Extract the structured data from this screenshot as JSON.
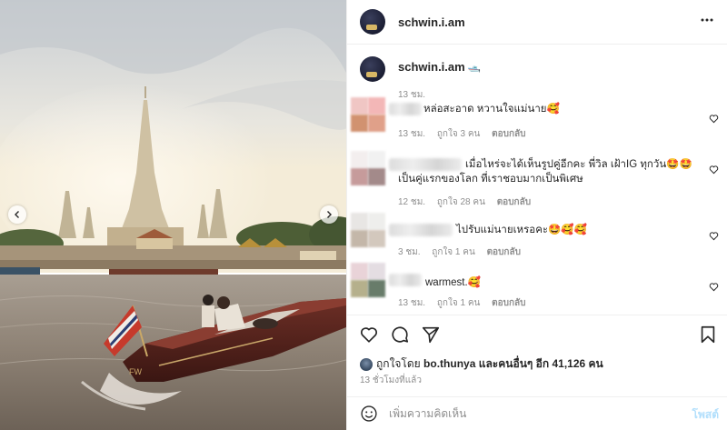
{
  "post": {
    "username": "schwin.i.am",
    "more_icon": "more-horizontal-icon",
    "caption": {
      "username": "schwin.i.am",
      "emoji": "🛥️",
      "time": "13 ชม."
    },
    "comments": [
      {
        "text": "หล่อสะอาด หวานใจแม่นาย🥰",
        "time": "13 ชม.",
        "likes": "ถูกใจ 3 คน",
        "reply": "ตอบกลับ"
      },
      {
        "text_line1": "เมื่อไหร่จะได้เห็นรูปคู่อีกคะ พี่วิล เฝ้าIG ทุกวัน🤩🤩",
        "text_line2": "เป็นคู่แรกของโลก ที่เราชอบมากเป็นพิเศษ",
        "time": "12 ชม.",
        "likes": "ถูกใจ 28 คน",
        "reply": "ตอบกลับ"
      },
      {
        "text": "ไปรับแม่นายเหรอคะ🤩🥰🥰",
        "time": "3 ชม.",
        "likes": "ถูกใจ 1 คน",
        "reply": "ตอบกลับ"
      },
      {
        "text": "warmest.🥰",
        "time": "13 ชม.",
        "likes": "ถูกใจ 1 คน",
        "reply": "ตอบกลับ"
      }
    ],
    "liked_by": {
      "prefix": "ถูกใจโดย",
      "user": "bo.thunya",
      "suffix": "และคนอื่นๆ อีก 41,126 คน"
    },
    "posted_time": "13 ชั่วโมงที่แล้ว",
    "add_comment": {
      "placeholder": "เพิ่มความคิดเห็น",
      "post_label": "โพสต์"
    },
    "icons": [
      "heart-icon",
      "comment-icon",
      "share-icon",
      "bookmark-icon",
      "emoji-icon",
      "chevron-left-icon",
      "chevron-right-icon"
    ],
    "colors": {
      "text": "#262626",
      "secondary": "#8e8e8e",
      "post_button": "#b2dffc",
      "border": "#efefef"
    }
  }
}
